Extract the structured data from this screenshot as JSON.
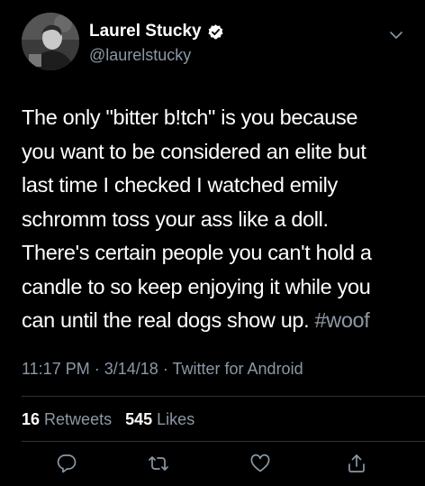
{
  "author": {
    "display_name": "Laurel Stucky",
    "handle": "@laurelstucky",
    "verified": true,
    "avatar_icon": "profile-photo"
  },
  "tweet": {
    "text_lines": [
      "The only \"bitter b!tch\" is you because",
      "you want to be considered an elite but",
      "last time I checked I watched emily",
      "schromm toss your ass like a doll.",
      "There's certain people you can't hold a",
      "candle to so keep enjoying it while you",
      "can until the real dogs show up. "
    ],
    "hashtag": "#woof",
    "time": "11:17 PM",
    "date": "3/14/18",
    "source": "Twitter for Android",
    "separator": "·"
  },
  "stats": {
    "retweets_count": "16",
    "retweets_label": "Retweets",
    "likes_count": "545",
    "likes_label": "Likes"
  },
  "actions": [
    {
      "name": "reply",
      "icon": "reply-icon"
    },
    {
      "name": "retweet",
      "icon": "retweet-icon"
    },
    {
      "name": "like",
      "icon": "heart-icon"
    },
    {
      "name": "share",
      "icon": "share-icon"
    }
  ],
  "colors": {
    "background": "#000000",
    "text": "#ffffff",
    "secondary": "#8b98a5",
    "verified_badge": "#ffffff",
    "divider": "#2f3336"
  }
}
